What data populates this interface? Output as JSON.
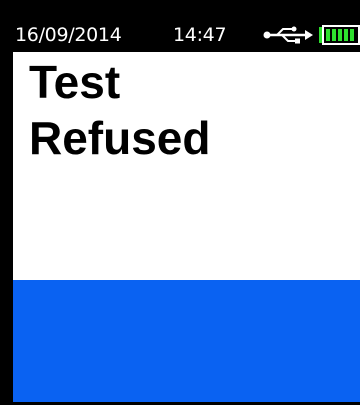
{
  "status_bar": {
    "date": "16/09/2014",
    "time": "14:47",
    "usb_icon": "usb-icon",
    "battery_icon": "battery-icon",
    "battery_color": "#2ee02e"
  },
  "message": {
    "line1": "Test",
    "line2": "Refused"
  },
  "colors": {
    "panel": "#0a62f2",
    "screen_bg": "#ffffff",
    "status_bg": "#000000"
  }
}
